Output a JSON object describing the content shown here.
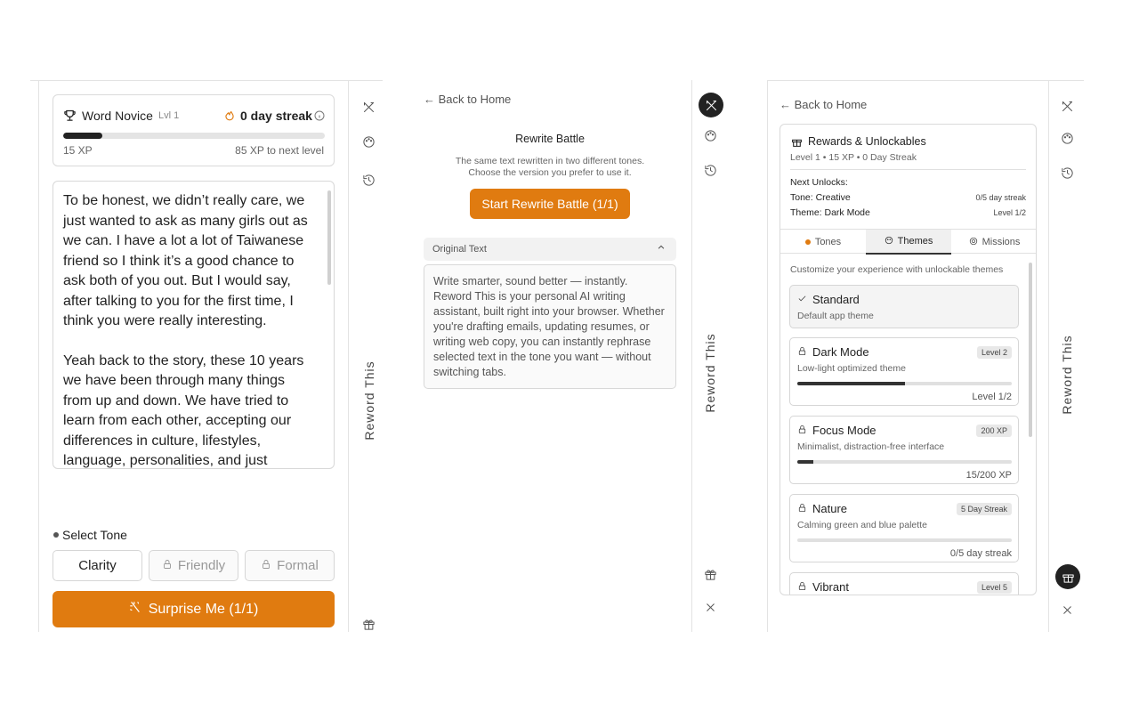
{
  "panel1": {
    "level_title": "Word Novice",
    "level_badge": "Lvl 1",
    "streak": "0 day streak",
    "xp_progress": 0.15,
    "xp_current": "15 XP",
    "xp_next": "85 XP to next level",
    "paragraphs": [
      "To be honest, we didn’t really care, we just wanted to ask as many girls out as we can. I have a lot a lot of Taiwanese friend so I think it’s a good chance to ask both of you out. But I would say, after talking to you for the first time, I think you were really interesting.",
      "Yeah back to the story, these 10 years we have been through many things from up and down. We have tried to learn from each other, accepting our differences in culture, lifestyles, language, personalities, and just"
    ],
    "select_tone_label": "Select Tone",
    "tones": [
      {
        "label": "Clarity",
        "locked": false
      },
      {
        "label": "Friendly",
        "locked": true
      },
      {
        "label": "Formal",
        "locked": true
      }
    ],
    "surprise_button": "Surprise Me (1/1)",
    "rail_label": "Reword This"
  },
  "panel2": {
    "back_link": "Back to Home",
    "title": "Rewrite Battle",
    "subtitle_line1": "The same text rewritten in two different tones.",
    "subtitle_line2": "Choose the version you prefer to use it.",
    "start_button": "Start Rewrite Battle (1/1)",
    "original_header": "Original Text",
    "original_text": "Write smarter, sound better — instantly. Reword This is your personal AI writing assistant, built right into your browser. Whether you're drafting emails, updating resumes, or writing web copy, you can instantly rephrase selected text in the tone you want — without switching tabs.",
    "rail_label": "Reword This"
  },
  "panel3": {
    "back_link": "Back to Home",
    "rewards_title": "Rewards & Unlockables",
    "rewards_sub": "Level 1 • 15 XP • 0 Day Streak",
    "next_unlocks_label": "Next Unlocks:",
    "unlocks": [
      {
        "name": "Tone: Creative",
        "req": "0/5 day streak"
      },
      {
        "name": "Theme: Dark Mode",
        "req": "Level 1/2"
      }
    ],
    "tabs": [
      "Tones",
      "Themes",
      "Missions"
    ],
    "themes_intro": "Customize your experience with unlockable themes",
    "themes": [
      {
        "name": "Standard",
        "desc": "Default app theme",
        "badge": "",
        "progress_text": "",
        "progress": null,
        "selected": true
      },
      {
        "name": "Dark Mode",
        "desc": "Low-light optimized theme",
        "badge": "Level 2",
        "progress_text": "Level 1/2",
        "progress": 0.5,
        "selected": false
      },
      {
        "name": "Focus Mode",
        "desc": "Minimalist, distraction-free interface",
        "badge": "200 XP",
        "progress_text": "15/200 XP",
        "progress": 0.075,
        "selected": false
      },
      {
        "name": "Nature",
        "desc": "Calming green and blue palette",
        "badge": "5 Day Streak",
        "progress_text": "0/5 day streak",
        "progress": 0,
        "selected": false
      },
      {
        "name": "Vibrant",
        "desc": "",
        "badge": "Level 5",
        "progress_text": "",
        "progress": null,
        "selected": false
      }
    ],
    "rail_label": "Reword This"
  },
  "colors": {
    "accent": "#e07b10",
    "dark": "#222222",
    "border": "#d8d8d8"
  },
  "icons": [
    "trophy-icon",
    "flame-icon",
    "info-icon",
    "swords-icon",
    "palette-icon",
    "history-icon",
    "gift-icon",
    "close-icon",
    "lock-icon",
    "sparkles-icon",
    "check-icon",
    "chevron-up-icon",
    "arrow-left-icon"
  ]
}
